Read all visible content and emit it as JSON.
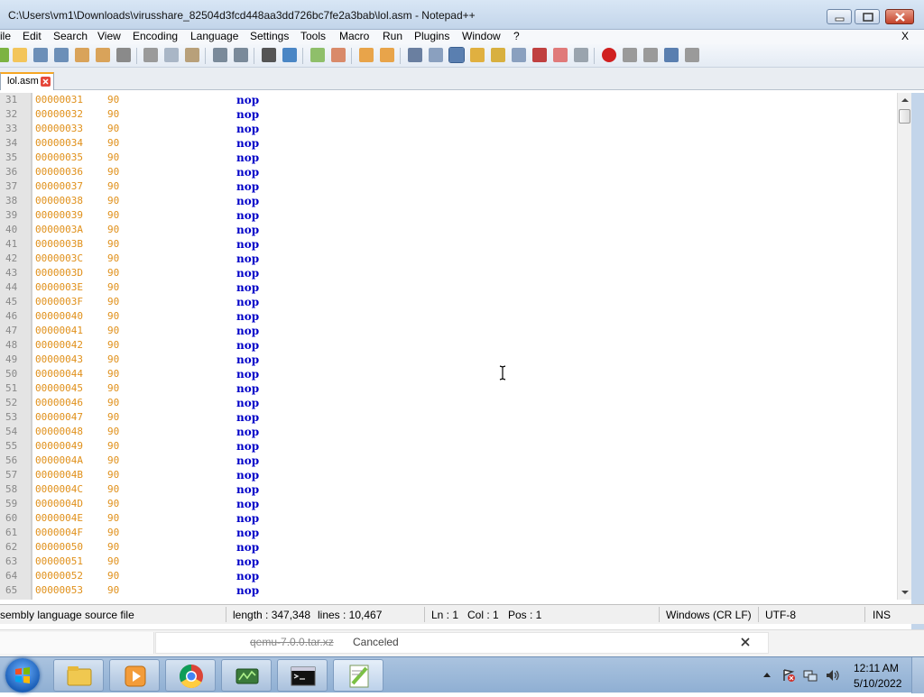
{
  "window": {
    "title": "C:\\Users\\vm1\\Downloads\\virusshare_82504d3fcd448aa3dd726bc7fe2a3bab\\lol.asm - Notepad++"
  },
  "menu": {
    "items": [
      "ile",
      "Edit",
      "Search",
      "View",
      "Encoding",
      "Language",
      "Settings",
      "Tools",
      "Macro",
      "Run",
      "Plugins",
      "Window",
      "?"
    ],
    "close_x": "X"
  },
  "tab": {
    "label": "lol.asm"
  },
  "editor": {
    "lines": [
      {
        "n": "31",
        "addr": "00000031",
        "bytes": "90",
        "instr": "nop"
      },
      {
        "n": "32",
        "addr": "00000032",
        "bytes": "90",
        "instr": "nop"
      },
      {
        "n": "33",
        "addr": "00000033",
        "bytes": "90",
        "instr": "nop"
      },
      {
        "n": "34",
        "addr": "00000034",
        "bytes": "90",
        "instr": "nop"
      },
      {
        "n": "35",
        "addr": "00000035",
        "bytes": "90",
        "instr": "nop"
      },
      {
        "n": "36",
        "addr": "00000036",
        "bytes": "90",
        "instr": "nop"
      },
      {
        "n": "37",
        "addr": "00000037",
        "bytes": "90",
        "instr": "nop"
      },
      {
        "n": "38",
        "addr": "00000038",
        "bytes": "90",
        "instr": "nop"
      },
      {
        "n": "39",
        "addr": "00000039",
        "bytes": "90",
        "instr": "nop"
      },
      {
        "n": "40",
        "addr": "0000003A",
        "bytes": "90",
        "instr": "nop"
      },
      {
        "n": "41",
        "addr": "0000003B",
        "bytes": "90",
        "instr": "nop"
      },
      {
        "n": "42",
        "addr": "0000003C",
        "bytes": "90",
        "instr": "nop"
      },
      {
        "n": "43",
        "addr": "0000003D",
        "bytes": "90",
        "instr": "nop"
      },
      {
        "n": "44",
        "addr": "0000003E",
        "bytes": "90",
        "instr": "nop"
      },
      {
        "n": "45",
        "addr": "0000003F",
        "bytes": "90",
        "instr": "nop"
      },
      {
        "n": "46",
        "addr": "00000040",
        "bytes": "90",
        "instr": "nop"
      },
      {
        "n": "47",
        "addr": "00000041",
        "bytes": "90",
        "instr": "nop"
      },
      {
        "n": "48",
        "addr": "00000042",
        "bytes": "90",
        "instr": "nop"
      },
      {
        "n": "49",
        "addr": "00000043",
        "bytes": "90",
        "instr": "nop"
      },
      {
        "n": "50",
        "addr": "00000044",
        "bytes": "90",
        "instr": "nop"
      },
      {
        "n": "51",
        "addr": "00000045",
        "bytes": "90",
        "instr": "nop"
      },
      {
        "n": "52",
        "addr": "00000046",
        "bytes": "90",
        "instr": "nop"
      },
      {
        "n": "53",
        "addr": "00000047",
        "bytes": "90",
        "instr": "nop"
      },
      {
        "n": "54",
        "addr": "00000048",
        "bytes": "90",
        "instr": "nop"
      },
      {
        "n": "55",
        "addr": "00000049",
        "bytes": "90",
        "instr": "nop"
      },
      {
        "n": "56",
        "addr": "0000004A",
        "bytes": "90",
        "instr": "nop"
      },
      {
        "n": "57",
        "addr": "0000004B",
        "bytes": "90",
        "instr": "nop"
      },
      {
        "n": "58",
        "addr": "0000004C",
        "bytes": "90",
        "instr": "nop"
      },
      {
        "n": "59",
        "addr": "0000004D",
        "bytes": "90",
        "instr": "nop"
      },
      {
        "n": "60",
        "addr": "0000004E",
        "bytes": "90",
        "instr": "nop"
      },
      {
        "n": "61",
        "addr": "0000004F",
        "bytes": "90",
        "instr": "nop"
      },
      {
        "n": "62",
        "addr": "00000050",
        "bytes": "90",
        "instr": "nop"
      },
      {
        "n": "63",
        "addr": "00000051",
        "bytes": "90",
        "instr": "nop"
      },
      {
        "n": "64",
        "addr": "00000052",
        "bytes": "90",
        "instr": "nop"
      },
      {
        "n": "65",
        "addr": "00000053",
        "bytes": "90",
        "instr": "nop"
      }
    ],
    "colors": {
      "address": "#e0901a",
      "instruction": "#0000c8",
      "line_number": "#888888"
    }
  },
  "status": {
    "file_type": "sembly language source file",
    "length": "length : 347,348",
    "lines": "lines : 10,467",
    "ln": "Ln : 1",
    "col": "Col : 1",
    "pos": "Pos : 1",
    "eol": "Windows (CR LF)",
    "encoding": "UTF-8",
    "mode": "INS"
  },
  "download": {
    "filename": "qemu-7.0.0.tar.xz",
    "status": "Canceled"
  },
  "taskbar": {
    "apps": [
      "explorer-icon",
      "media-player-icon",
      "chrome-icon",
      "network-tool-icon",
      "cmd-icon",
      "notepadpp-icon"
    ],
    "time": "12:11 AM",
    "date": "5/10/2022"
  }
}
